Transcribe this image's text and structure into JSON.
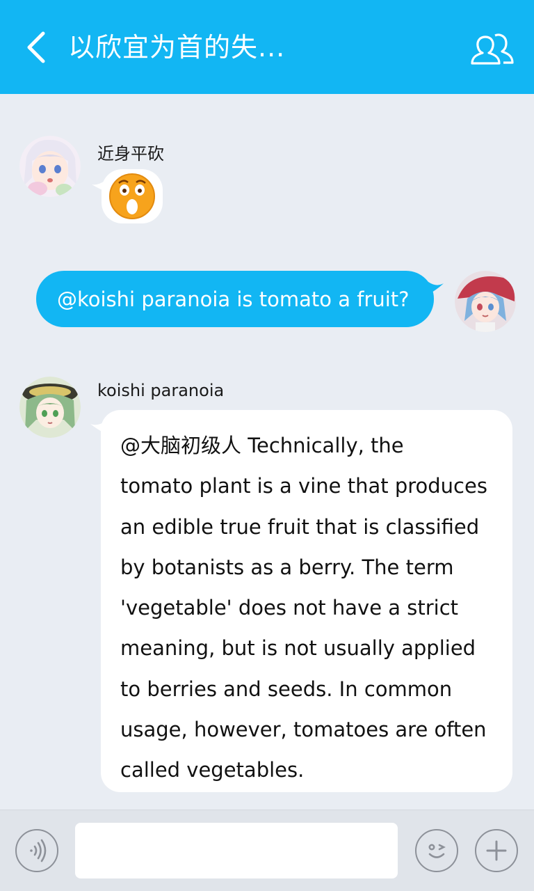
{
  "header": {
    "title": "以欣宜为首的失...",
    "back_icon": "chevron-left-icon",
    "members_icon": "group-members-icon",
    "background_color": "#12b6f3"
  },
  "messages": [
    {
      "direction": "incoming",
      "sender": "近身平砍",
      "avatar": "avatar-white-haired-girl",
      "content_type": "emoji",
      "emoji": "shocked-face-emoji"
    },
    {
      "direction": "outgoing",
      "avatar": "avatar-blue-haired-girl-umbrella",
      "content_type": "text",
      "text": "@koishi paranoia is tomato a fruit?"
    },
    {
      "direction": "incoming",
      "sender": "koishi paranoia",
      "avatar": "avatar-green-haired-girl-hat",
      "content_type": "text",
      "text": "@大脑初级人 Technically, the\ntomato plant is a vine that produces\nan edible true fruit that is classified\nby botanists as a berry. The term\n'vegetable' does not have a strict\nmeaning, but is not usually applied\nto berries and seeds. In common\nusage, however, tomatoes are often\ncalled vegetables."
    }
  ],
  "composer": {
    "voice_icon": "voice-input-icon",
    "input_value": "",
    "emoji_icon": "emoji-picker-icon",
    "more_icon": "plus-icon"
  }
}
